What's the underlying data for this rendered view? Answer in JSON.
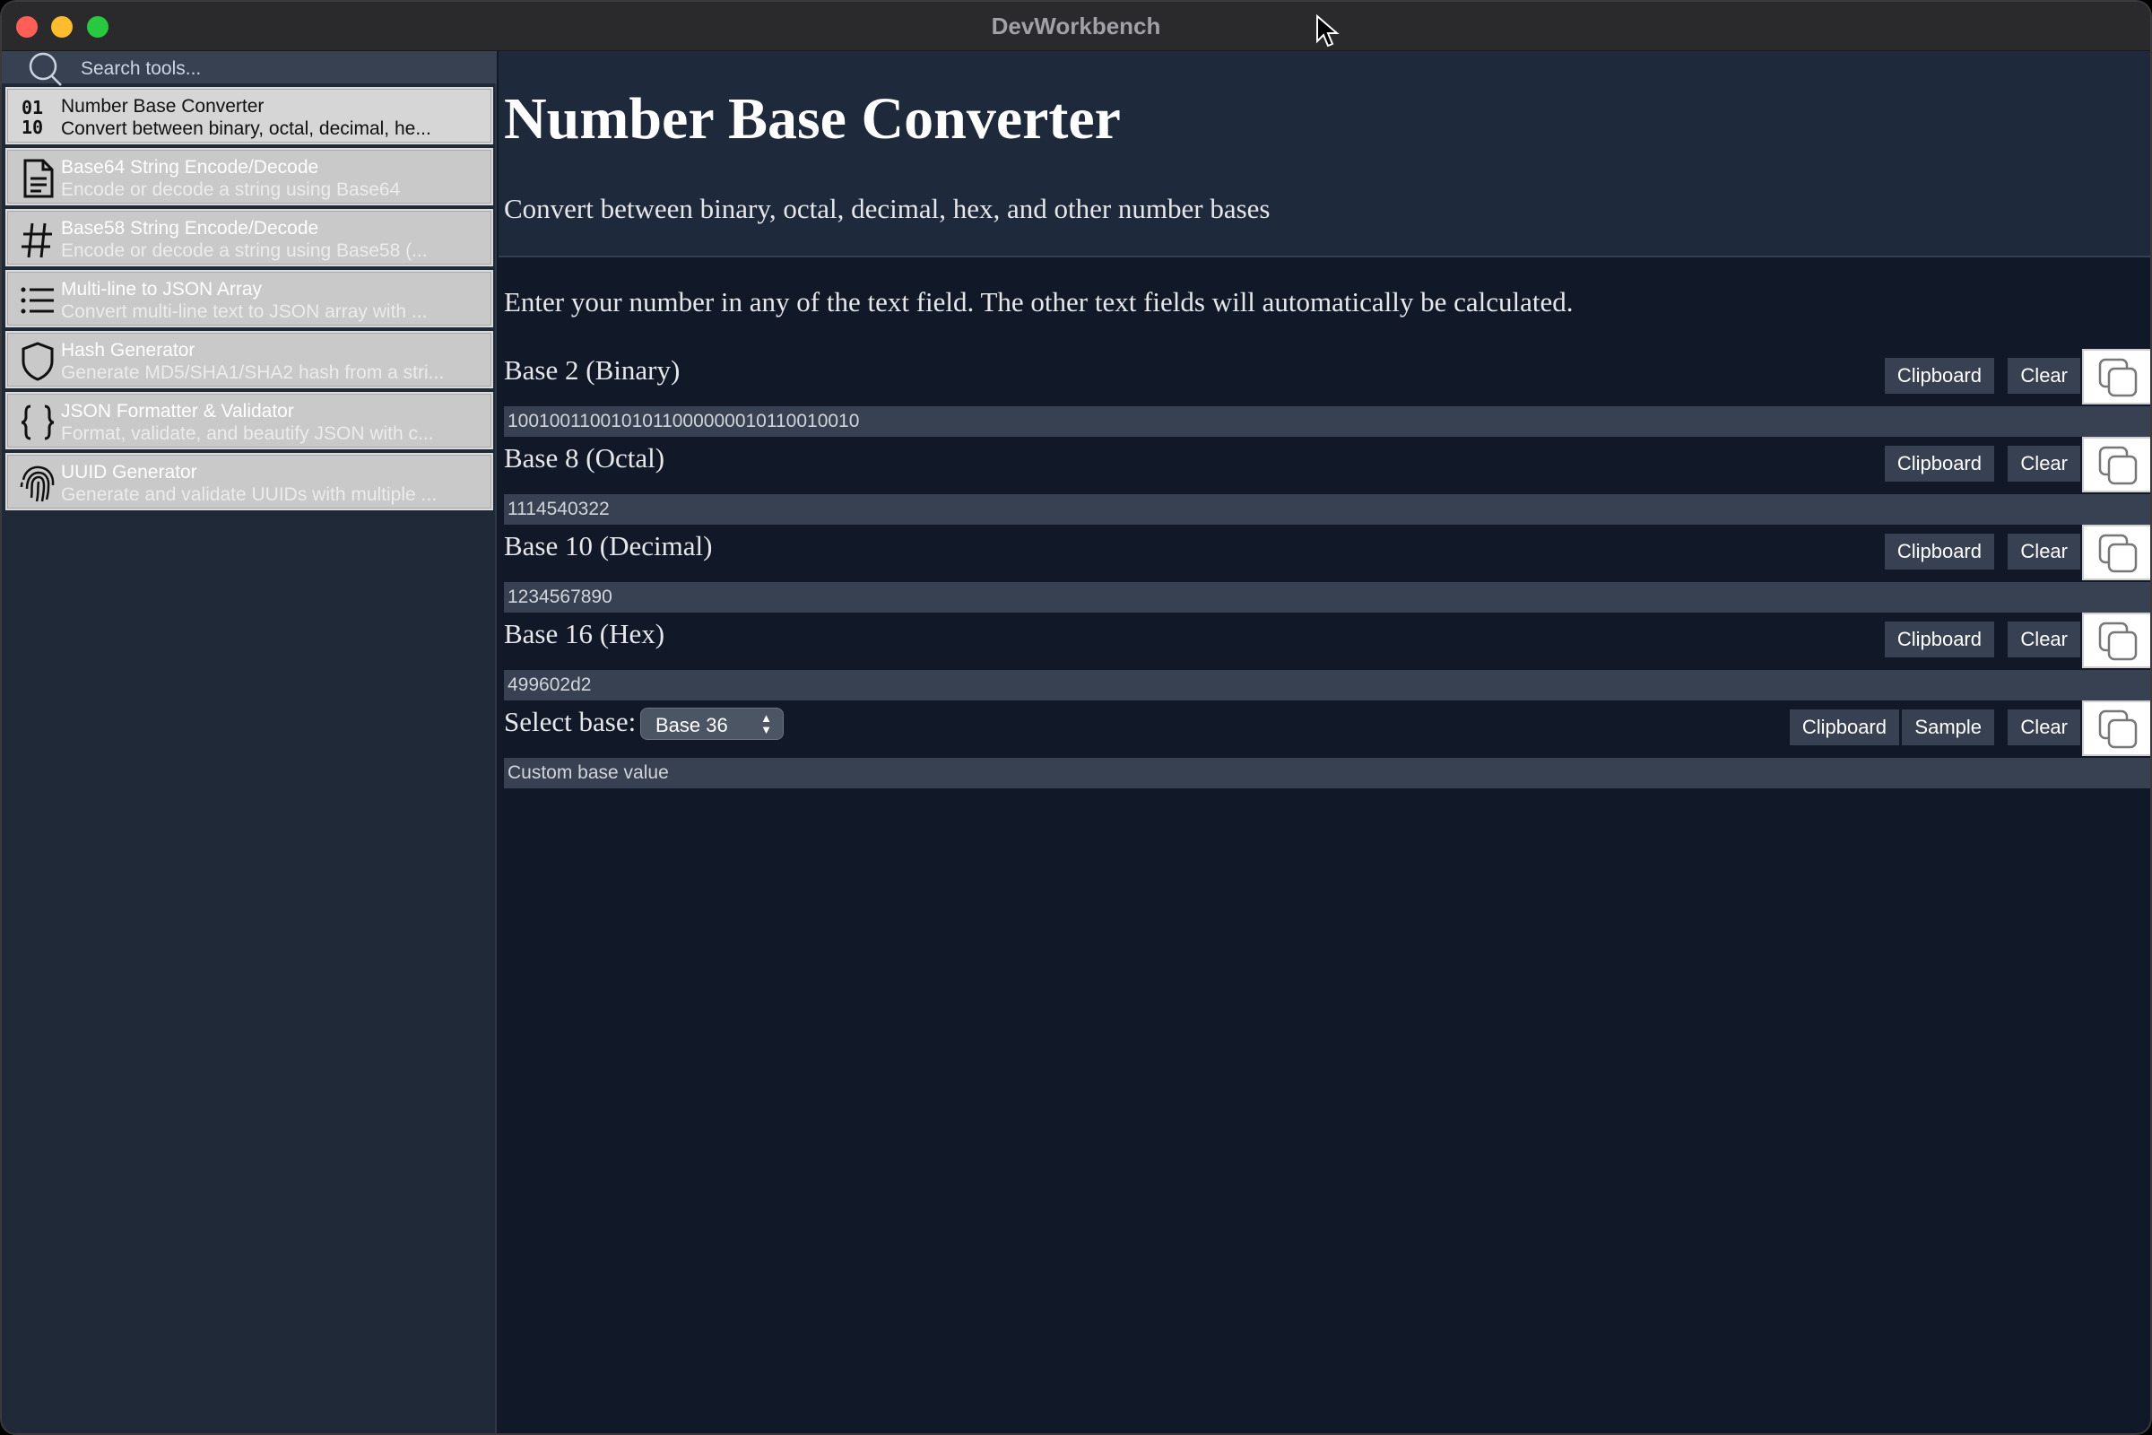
{
  "window": {
    "title": "DevWorkbench"
  },
  "sidebar": {
    "search_placeholder": "Search tools...",
    "tools": [
      {
        "name": "Number Base Converter",
        "description": "Convert between binary, octal, decimal, he...",
        "icon": "binary-icon",
        "active": true
      },
      {
        "name": "Base64 String Encode/Decode",
        "description": "Encode or decode a string using Base64",
        "icon": "document-icon"
      },
      {
        "name": "Base58 String Encode/Decode",
        "description": "Encode or decode a string using Base58 (...",
        "icon": "hash-icon"
      },
      {
        "name": "Multi-line to JSON Array",
        "description": "Convert multi-line text to JSON array with ...",
        "icon": "list-icon"
      },
      {
        "name": "Hash Generator",
        "description": "Generate MD5/SHA1/SHA2 hash from a stri...",
        "icon": "shield-icon"
      },
      {
        "name": "JSON Formatter & Validator",
        "description": "Format, validate, and beautify JSON with c...",
        "icon": "braces-icon"
      },
      {
        "name": "UUID Generator",
        "description": "Generate and validate UUIDs with multiple ...",
        "icon": "fingerprint-icon"
      }
    ]
  },
  "main": {
    "title": "Number Base Converter",
    "subtitle": "Convert between binary, octal, decimal, hex, and other number bases",
    "instructions": "Enter your number in any of the text field. The other text fields will automatically be calculated.",
    "buttons": {
      "clipboard": "Clipboard",
      "clear": "Clear",
      "sample": "Sample"
    },
    "rows": [
      {
        "label": "Base 2 (Binary)",
        "value": "1001001100101011000000010110010010"
      },
      {
        "label": "Base 8 (Octal)",
        "value": "1114540322"
      },
      {
        "label": "Base 10 (Decimal)",
        "value": "1234567890"
      },
      {
        "label": "Base 16 (Hex)",
        "value": "499602d2"
      }
    ],
    "custom": {
      "label": "Select base:",
      "selected_base": "Base 36",
      "placeholder": "Custom base value",
      "value": ""
    }
  },
  "colors": {
    "background": "#111827",
    "header": "#1e293b",
    "field": "#374151",
    "sidebar": "#1f2937"
  }
}
